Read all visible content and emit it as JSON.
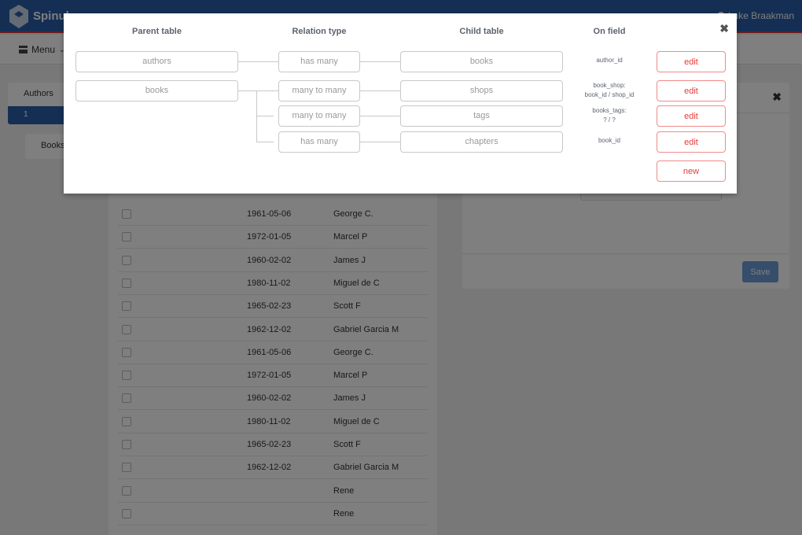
{
  "app": {
    "brand": "Spinul",
    "user_name": "Luke Braakman",
    "menu_label": "Menu"
  },
  "sidebar": {
    "title": "Authors",
    "selected_item": "1",
    "books_tab": "Books"
  },
  "list": {
    "rows": [
      {
        "date": "1961-05-06",
        "name": "George C."
      },
      {
        "date": "1972-01-05",
        "name": "Marcel P"
      },
      {
        "date": "1960-02-02",
        "name": "James J"
      },
      {
        "date": "1980-11-02",
        "name": "Miguel de C"
      },
      {
        "date": "1965-02-23",
        "name": "Scott F"
      },
      {
        "date": "1962-12-02",
        "name": "Gabriel Garcia M"
      },
      {
        "date": "1961-05-06",
        "name": "George C."
      },
      {
        "date": "1972-01-05",
        "name": "Marcel P"
      },
      {
        "date": "1960-02-02",
        "name": "James J"
      },
      {
        "date": "1980-11-02",
        "name": "Miguel de C"
      },
      {
        "date": "1965-02-23",
        "name": "Scott F"
      },
      {
        "date": "1962-12-02",
        "name": "Gabriel Garcia M"
      },
      {
        "date": "",
        "name": "Rene"
      },
      {
        "date": "",
        "name": "Rene"
      }
    ]
  },
  "form": {
    "save_label": "Save",
    "close_glyph": "✖"
  },
  "modal": {
    "close_glyph": "✖",
    "headers": {
      "parent": "Parent table",
      "relation": "Relation type",
      "child": "Child table",
      "field": "On field"
    },
    "relations": [
      {
        "parent": "authors",
        "type": "has many",
        "child": "books",
        "field_line1": "author_id",
        "field_line2": "",
        "action": "edit"
      },
      {
        "parent": "books",
        "type": "many to many",
        "child": "shops",
        "field_line1": "book_shop:",
        "field_line2": "book_id / shop_id",
        "action": "edit"
      },
      {
        "parent": "",
        "type": "many to many",
        "child": "tags",
        "field_line1": "books_tags:",
        "field_line2": "? / ?",
        "action": "edit"
      },
      {
        "parent": "",
        "type": "has many",
        "child": "chapters",
        "field_line1": "book_id",
        "field_line2": "",
        "action": "edit"
      }
    ],
    "new_label": "new"
  },
  "colors": {
    "brand_blue": "#2a5fa8",
    "accent_red": "#e83a3a"
  }
}
